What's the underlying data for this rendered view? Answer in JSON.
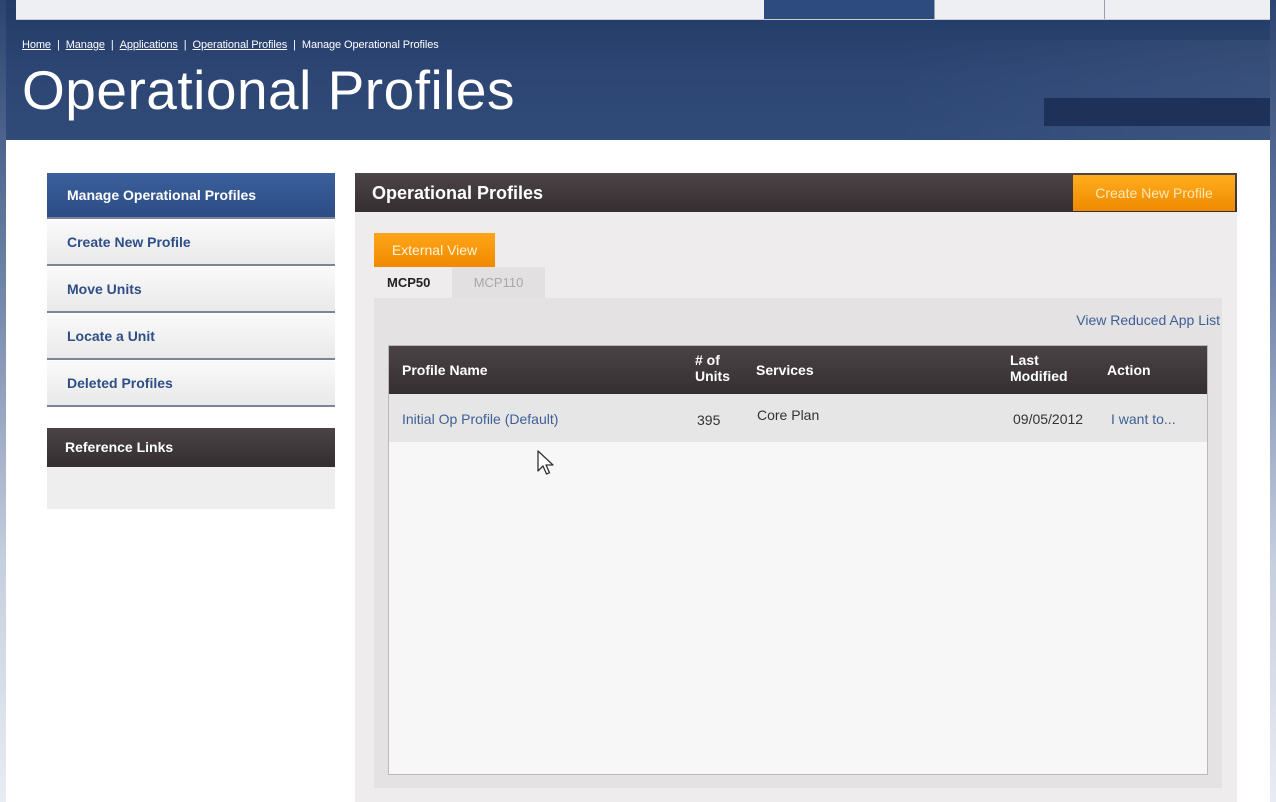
{
  "breadcrumb": [
    {
      "label": "Home"
    },
    {
      "label": "Manage"
    },
    {
      "label": "Applications"
    },
    {
      "label": "Operational Profiles"
    },
    {
      "label": "Manage Operational Profiles"
    }
  ],
  "page_title": "Operational Profiles",
  "sidebar": {
    "items": [
      {
        "label": "Manage Operational Profiles",
        "active": true
      },
      {
        "label": "Create New Profile"
      },
      {
        "label": "Move Units"
      },
      {
        "label": "Locate a Unit"
      },
      {
        "label": "Deleted Profiles"
      }
    ],
    "reference_links": {
      "title": "Reference Links"
    }
  },
  "main": {
    "title": "Operational Profiles",
    "create_button": "Create New Profile",
    "external_view_button": "External View",
    "tabs": [
      {
        "label": "MCP50",
        "active": true
      },
      {
        "label": "MCP110"
      }
    ],
    "reduced_link": "View Reduced App List",
    "table": {
      "columns": [
        "Profile Name",
        "# of Units",
        "Services",
        "Last Modified",
        "Action"
      ],
      "column_lines": {
        "units": [
          "# of",
          "Units"
        ],
        "modified": [
          "Last",
          "Modified"
        ]
      },
      "rows": [
        {
          "profile_name": "Initial Op Profile (Default)",
          "units": "395",
          "services": "Core Plan",
          "last_modified": "09/05/2012",
          "action": "I want to..."
        }
      ]
    }
  },
  "colors": {
    "header_blue": "#2d4674",
    "nav_active": "#2c4c85",
    "dark_bar": "#3b3437",
    "orange": "#f79200",
    "link_blue": "#3e5f96"
  },
  "icons": {
    "cursor": "mouse-pointer-icon"
  }
}
